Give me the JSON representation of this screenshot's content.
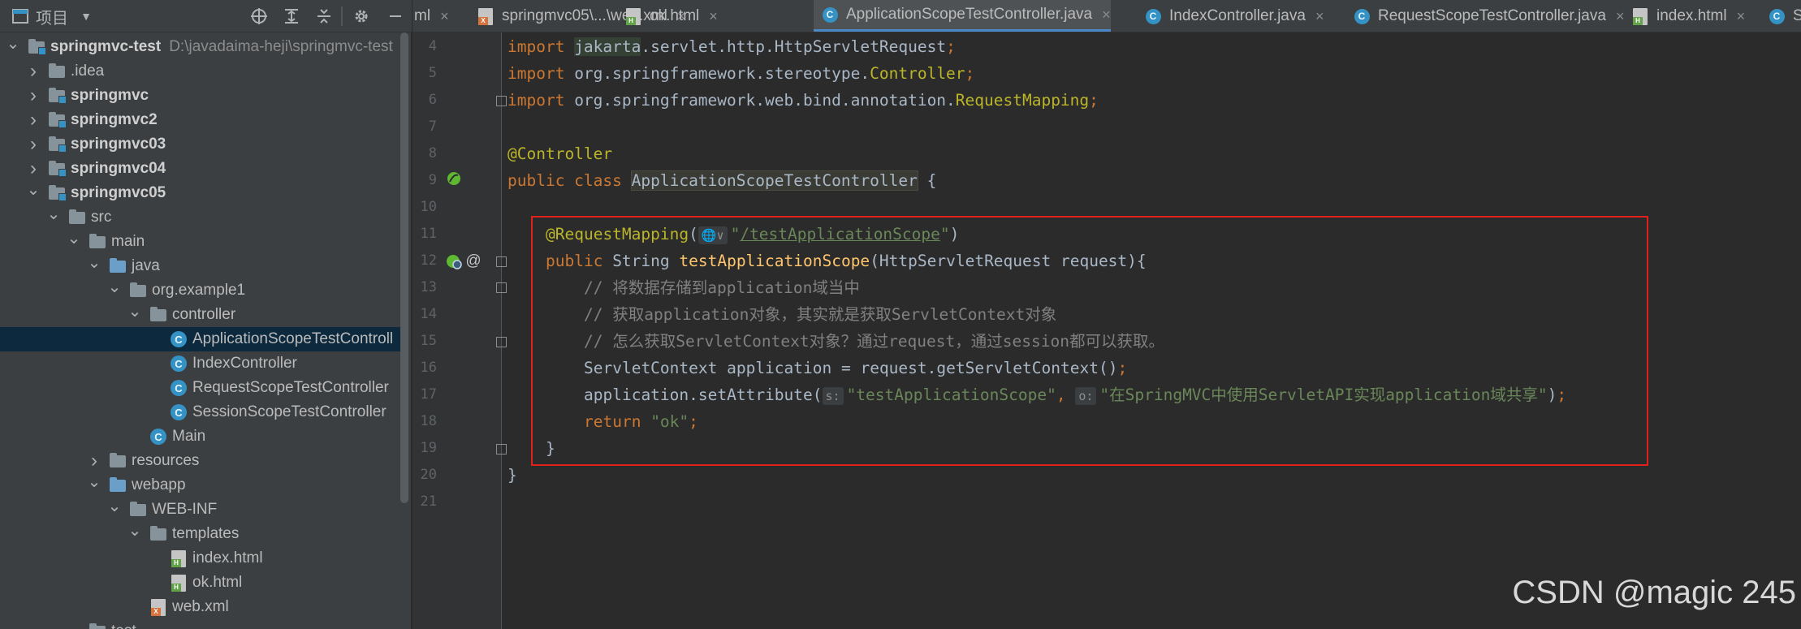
{
  "project_panel": {
    "title": "项目",
    "tree": [
      {
        "label": "springmvc-test",
        "path": "D:\\javadaima-heji\\springmvc-test",
        "indent": 0,
        "arrow": "down",
        "icon": "module-folder",
        "bold": true
      },
      {
        "label": ".idea",
        "indent": 1,
        "arrow": "right",
        "icon": "folder"
      },
      {
        "label": "springmvc",
        "indent": 1,
        "arrow": "right",
        "icon": "module-folder",
        "bold": true
      },
      {
        "label": "springmvc2",
        "indent": 1,
        "arrow": "right",
        "icon": "module-folder",
        "bold": true
      },
      {
        "label": "springmvc03",
        "indent": 1,
        "arrow": "right",
        "icon": "module-folder",
        "bold": true
      },
      {
        "label": "springmvc04",
        "indent": 1,
        "arrow": "right",
        "icon": "module-folder",
        "bold": true
      },
      {
        "label": "springmvc05",
        "indent": 1,
        "arrow": "down",
        "icon": "module-folder",
        "bold": true
      },
      {
        "label": "src",
        "indent": 2,
        "arrow": "down",
        "icon": "folder"
      },
      {
        "label": "main",
        "indent": 3,
        "arrow": "down",
        "icon": "folder"
      },
      {
        "label": "java",
        "indent": 4,
        "arrow": "down",
        "icon": "blue-folder"
      },
      {
        "label": "org.example1",
        "indent": 5,
        "arrow": "down",
        "icon": "package"
      },
      {
        "label": "controller",
        "indent": 6,
        "arrow": "down",
        "icon": "package"
      },
      {
        "label": "ApplicationScopeTestControll",
        "indent": 7,
        "arrow": "none",
        "icon": "class",
        "selected": true
      },
      {
        "label": "IndexController",
        "indent": 7,
        "arrow": "none",
        "icon": "class"
      },
      {
        "label": "RequestScopeTestController",
        "indent": 7,
        "arrow": "none",
        "icon": "class"
      },
      {
        "label": "SessionScopeTestController",
        "indent": 7,
        "arrow": "none",
        "icon": "class"
      },
      {
        "label": "Main",
        "indent": 6,
        "arrow": "none",
        "icon": "class"
      },
      {
        "label": "resources",
        "indent": 4,
        "arrow": "right",
        "icon": "folder"
      },
      {
        "label": "webapp",
        "indent": 4,
        "arrow": "down",
        "icon": "web-folder"
      },
      {
        "label": "WEB-INF",
        "indent": 5,
        "arrow": "down",
        "icon": "folder"
      },
      {
        "label": "templates",
        "indent": 6,
        "arrow": "down",
        "icon": "folder"
      },
      {
        "label": "index.html",
        "indent": 7,
        "arrow": "none",
        "icon": "html-file"
      },
      {
        "label": "ok.html",
        "indent": 7,
        "arrow": "none",
        "icon": "html-file"
      },
      {
        "label": "web.xml",
        "indent": 6,
        "arrow": "none",
        "icon": "xml-file"
      },
      {
        "label": "test",
        "indent": 3,
        "arrow": "down",
        "icon": "folder"
      }
    ]
  },
  "tabs": [
    {
      "label": "ml",
      "icon": "xml-file",
      "active": false
    },
    {
      "label": "springmvc05\\...\\web.xml",
      "icon": "xml-file",
      "active": false
    },
    {
      "label": "ok.html",
      "icon": "html-file",
      "active": false
    },
    {
      "label": "ApplicationScopeTestController.java",
      "icon": "class",
      "active": true
    },
    {
      "label": "IndexController.java",
      "icon": "class",
      "active": false
    },
    {
      "label": "RequestScopeTestController.java",
      "icon": "class",
      "active": false
    },
    {
      "label": "index.html",
      "icon": "html-file",
      "active": false
    },
    {
      "label": "S",
      "icon": "class",
      "active": false
    }
  ],
  "editor": {
    "lines": [
      {
        "n": "4",
        "indent": 0,
        "tokens": [
          [
            "kw",
            "import "
          ],
          [
            "pkg-hl",
            "jakarta"
          ],
          [
            "",
            "."
          ],
          [
            "",
            "servlet.http.HttpServletRequest"
          ],
          [
            "kw",
            ";"
          ]
        ]
      },
      {
        "n": "5",
        "indent": 0,
        "tokens": [
          [
            "kw",
            "import "
          ],
          [
            "",
            "org.springframework.stereotype."
          ],
          [
            "ann",
            "Controller"
          ],
          [
            "kw",
            ";"
          ]
        ]
      },
      {
        "n": "6",
        "indent": 0,
        "tokens": [
          [
            "kw",
            "import "
          ],
          [
            "",
            "org.springframework.web.bind.annotation."
          ],
          [
            "ann",
            "RequestMapping"
          ],
          [
            "kw",
            ";"
          ]
        ]
      },
      {
        "n": "7",
        "indent": 0,
        "tokens": []
      },
      {
        "n": "8",
        "indent": 0,
        "tokens": [
          [
            "ann",
            "@Controller"
          ]
        ]
      },
      {
        "n": "9",
        "indent": 0,
        "tokens": [
          [
            "kw",
            "public class "
          ],
          [
            "cls-hl",
            "ApplicationScopeTestController"
          ],
          [
            "",
            " {"
          ]
        ]
      },
      {
        "n": "10",
        "indent": 0,
        "tokens": []
      },
      {
        "n": "11",
        "indent": 1,
        "tokens": [
          [
            "ann",
            "@RequestMapping"
          ],
          [
            "",
            "("
          ],
          [
            "hint",
            "🌐∨"
          ],
          [
            "str",
            "\""
          ],
          [
            "url",
            "/testApplicationScope"
          ],
          [
            "str",
            "\""
          ],
          [
            "",
            ")"
          ]
        ]
      },
      {
        "n": "12",
        "indent": 1,
        "tokens": [
          [
            "kw",
            "public "
          ],
          [
            "",
            "String "
          ],
          [
            "fn",
            "testApplicationScope"
          ],
          [
            "",
            "(HttpServletRequest request){"
          ]
        ]
      },
      {
        "n": "13",
        "indent": 2,
        "tokens": [
          [
            "cmt",
            "// 将数据存储到application域当中"
          ]
        ]
      },
      {
        "n": "14",
        "indent": 2,
        "tokens": [
          [
            "cmt",
            "// 获取application对象，其实就是获取ServletContext对象"
          ]
        ]
      },
      {
        "n": "15",
        "indent": 2,
        "tokens": [
          [
            "cmt",
            "// 怎么获取ServletContext对象？通过request，通过session都可以获取。"
          ]
        ]
      },
      {
        "n": "16",
        "indent": 2,
        "tokens": [
          [
            "",
            "ServletContext application = request.getServletContext()"
          ],
          [
            "kw",
            ";"
          ]
        ]
      },
      {
        "n": "17",
        "indent": 2,
        "tokens": [
          [
            "",
            "application.setAttribute("
          ],
          [
            "hint",
            "s:"
          ],
          [
            "str",
            "\"testApplicationScope\""
          ],
          [
            "kw",
            ", "
          ],
          [
            "hint",
            "o:"
          ],
          [
            "str",
            "\"在SpringMVC中使用ServletAPI实现application域共享\""
          ],
          [
            "",
            ")"
          ],
          [
            "kw",
            ";"
          ]
        ]
      },
      {
        "n": "18",
        "indent": 2,
        "tokens": [
          [
            "kw",
            "return "
          ],
          [
            "str",
            "\"ok\""
          ],
          [
            "kw",
            ";"
          ]
        ]
      },
      {
        "n": "19",
        "indent": 1,
        "tokens": [
          [
            "",
            "}"
          ]
        ]
      },
      {
        "n": "20",
        "indent": 0,
        "tokens": [
          [
            "",
            "}"
          ]
        ]
      },
      {
        "n": "21",
        "indent": 0,
        "tokens": []
      }
    ]
  },
  "watermark": "CSDN @magic 245",
  "colors": {
    "highlight_border": "#e0201b",
    "active_tab_underline": "#4a88c7",
    "selection": "#0d293e"
  }
}
